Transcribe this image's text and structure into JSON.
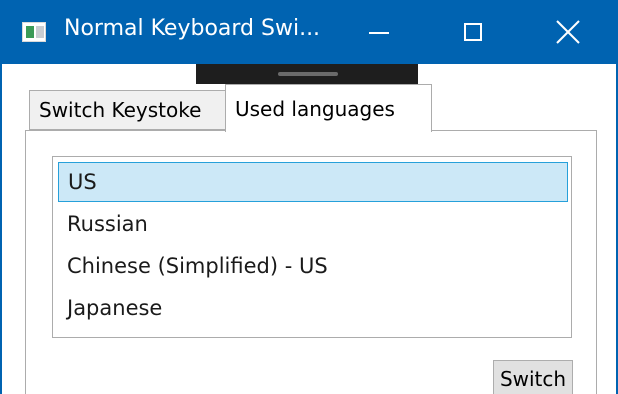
{
  "window": {
    "title": "Normal Keyboard Swi...",
    "caption_buttons": [
      "minimize",
      "maximize",
      "close"
    ]
  },
  "tabs": [
    {
      "label": "Switch Keystoke",
      "selected": false
    },
    {
      "label": "Used languages",
      "selected": true
    }
  ],
  "languages": {
    "items": [
      {
        "label": "US",
        "selected": true
      },
      {
        "label": "Russian",
        "selected": false
      },
      {
        "label": "Chinese (Simplified) - US",
        "selected": false
      },
      {
        "label": "Japanese",
        "selected": false
      }
    ]
  },
  "actions": {
    "switch_label": "Switch"
  },
  "colors": {
    "titlebar": "#0063b1",
    "selection_fill": "#cce8f7",
    "selection_border": "#26a0da"
  }
}
